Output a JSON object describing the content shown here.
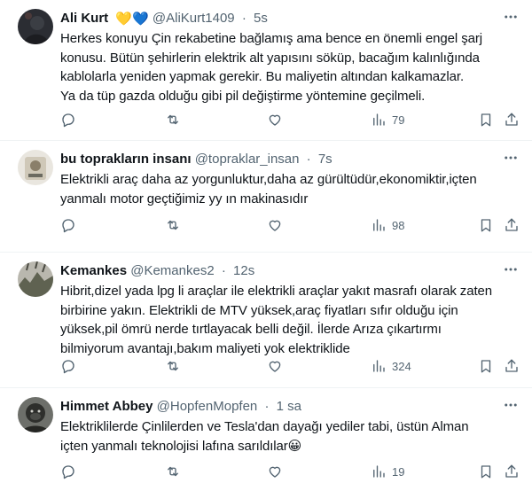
{
  "tweets": [
    {
      "name": "Ali Kurt",
      "emoji": "💛💙",
      "handle": "@AliKurt1409",
      "time": "5s",
      "text": "Herkes konuyu Çin rekabetine bağlamış ama bence en önemli engel şarj\nkonusu. Bütün şehirlerin elektrik alt yapısını söküp, bacağım kalınlığında\nkablolarla yeniden yapmak gerekir. Bu maliyetin altından kalkamazlar.\nYa da tüp gazda olduğu gibi pil değiştirme yöntemine geçilmeli.",
      "views": "79"
    },
    {
      "name": "bu toprakların insanı",
      "handle": "@topraklar_insan",
      "time": "7s",
      "text": "Elektrikli araç daha az yorgunluktur,daha az gürültüdür,ekonomiktir,içten\nyanmalı motor geçtiğimiz yy ın makinasıdır",
      "views": "98"
    },
    {
      "name": "Kemankes",
      "handle": "@Kemankes2",
      "time": "12s",
      "text": "Hibrit,dizel yada lpg li araçlar ile elektrikli araçlar yakıt masrafı olarak zaten\nbirbirine yakın. Elektrikli de MTV yüksek,araç fiyatları sıfır olduğu için\nyüksek,pil ömrü nerde tırtlayacak belli değil. İlerde Arıza çıkartırmı\nbilmiyorum avantajı,bakım maliyeti yok elektriklide",
      "views": "324"
    },
    {
      "name": "Himmet Abbey",
      "handle": "@HopfenMopfen",
      "time": "1 sa",
      "text": "Elektriklilerde Çinlilerden ve Tesla'dan dayağı yediler tabi, üstün Alman\niçten yanmalı teknolojisi lafına sarıldılar😀",
      "views": "19"
    }
  ],
  "separator": "·",
  "icons": {
    "reply": "reply-icon",
    "retweet": "retweet-icon",
    "like": "heart-icon",
    "views": "views-icon",
    "bookmark": "bookmark-icon",
    "share": "share-icon",
    "more": "more-icon"
  },
  "colors": {
    "text": "#0f1419",
    "secondary": "#536471",
    "divider": "#eff3f4"
  }
}
